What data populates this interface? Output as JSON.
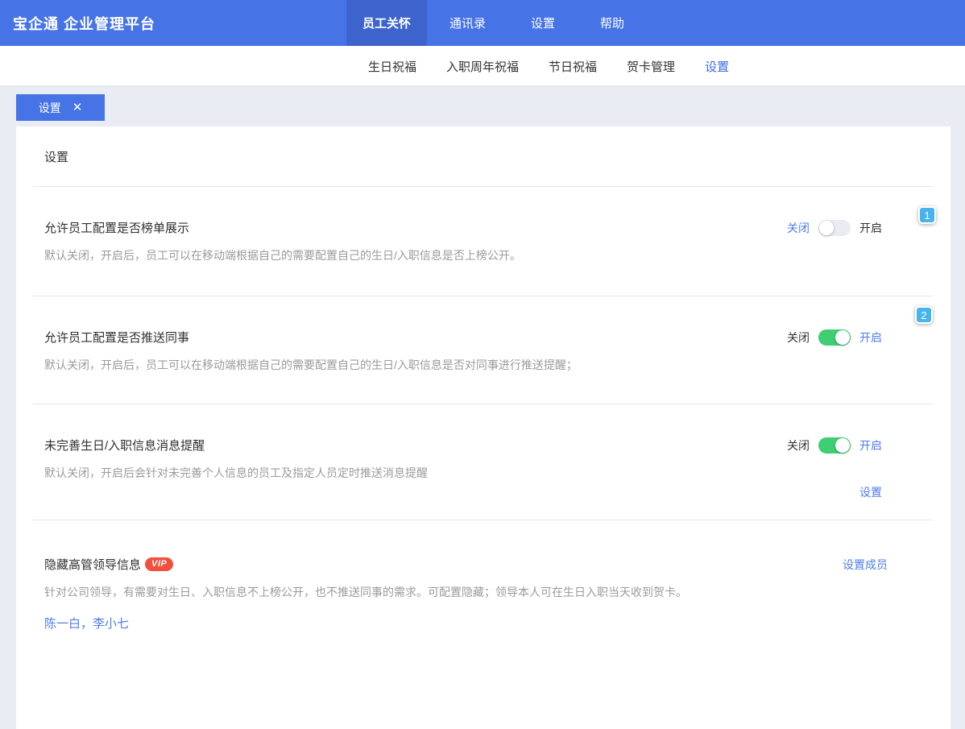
{
  "app": {
    "title": "宝企通 企业管理平台"
  },
  "header": {
    "tabs": [
      {
        "label": "员工关怀",
        "active": true
      },
      {
        "label": "通讯录",
        "active": false
      },
      {
        "label": "设置",
        "active": false
      },
      {
        "label": "帮助",
        "active": false
      }
    ]
  },
  "subnav": {
    "items": [
      {
        "label": "生日祝福",
        "active": false
      },
      {
        "label": "入职周年祝福",
        "active": false
      },
      {
        "label": "节日祝福",
        "active": false
      },
      {
        "label": "贺卡管理",
        "active": false
      },
      {
        "label": "设置",
        "active": true
      }
    ]
  },
  "tab_chip": {
    "label": "设置",
    "close_icon": "✕"
  },
  "panel": {
    "heading": "设置"
  },
  "settings": [
    {
      "title": "允许员工配置是否榜单展示",
      "description": "默认关闭，开启后，员工可以在移动端根据自己的需要配置自己的生日/入职信息是否上榜公开。",
      "off_label": "关闭",
      "on_label": "开启",
      "state": "off"
    },
    {
      "title": "允许员工配置是否推送同事",
      "description": "默认关闭，开启后，员工可以在移动端根据自己的需要配置自己的生日/入职信息是否对同事进行推送提醒；",
      "off_label": "关闭",
      "on_label": "开启",
      "state": "on"
    },
    {
      "title": "未完善生日/入职信息消息提醒",
      "description": "默认关闭，开启后会针对未完善个人信息的员工及指定人员定时推送消息提醒",
      "off_label": "关闭",
      "on_label": "开启",
      "state": "on",
      "link": "设置"
    },
    {
      "title": "隐藏高管领导信息",
      "badge": "VIP",
      "description": "针对公司领导，有需要对生日、入职信息不上榜公开，也不推送同事的需求。可配置隐藏；领导本人可在生日入职当天收到贺卡。",
      "action": "设置成员",
      "members": "陈一白，李小七"
    }
  ],
  "annotations": {
    "markers": [
      "1",
      "2"
    ]
  },
  "colors": {
    "header_blue": "#4673e5",
    "header_active_blue": "#3d63cd",
    "accent_blue": "#4f7ced",
    "toggle_on_green": "#3ecf72",
    "marker_blue": "#47b4ee",
    "vip_red": "#f2503f",
    "page_background": "#e9ecf2"
  }
}
